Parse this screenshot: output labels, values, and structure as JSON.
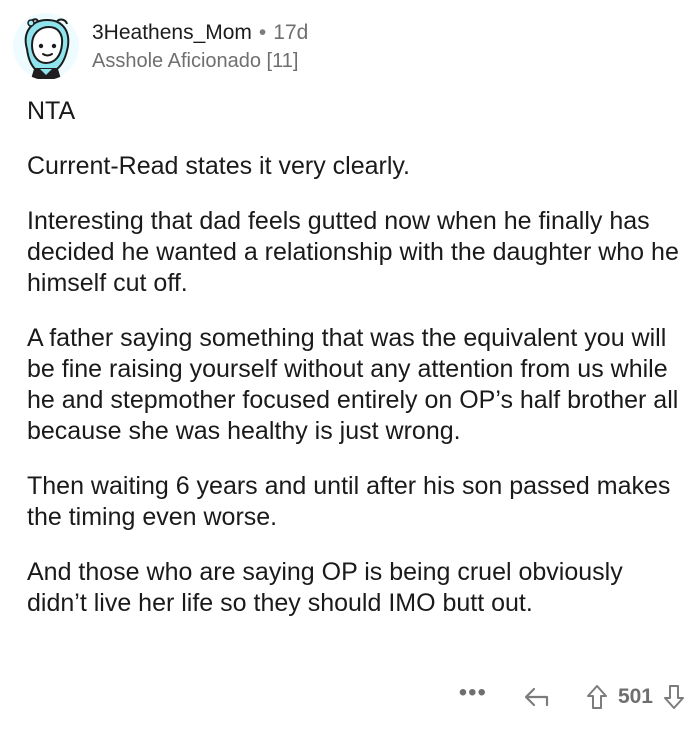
{
  "comment": {
    "username": "3Heathens_Mom",
    "separator": "•",
    "age": "17d",
    "flair": "Asshole Aficionado [11]",
    "paragraphs": [
      "NTA",
      "Current-Read states it very clearly.",
      "Interesting that dad feels gutted now when he finally has decided he wanted a relationship with the daughter who he himself cut off.",
      "A father saying something that was the equivalent you will be fine raising yourself without any attention from us while he and stepmother focused entirely on OP’s half brother all because she was healthy is just wrong.",
      "Then waiting 6 years and until after his son passed makes the timing even worse.",
      "And those who are saying OP is being cruel obviously didn’t live her life so they should IMO butt out."
    ],
    "actions": {
      "more": "•••",
      "vote_count": "501"
    }
  },
  "icons": {
    "avatar": "avatar-illustration",
    "reply": "reply-arrow-icon",
    "upvote": "upvote-arrow-icon",
    "downvote": "downvote-arrow-icon"
  },
  "colors": {
    "text": "#1a1a1b",
    "meta": "#6f6f6f",
    "avatar_hair": "#8fe3ec",
    "avatar_bg": "#dff7ff"
  }
}
